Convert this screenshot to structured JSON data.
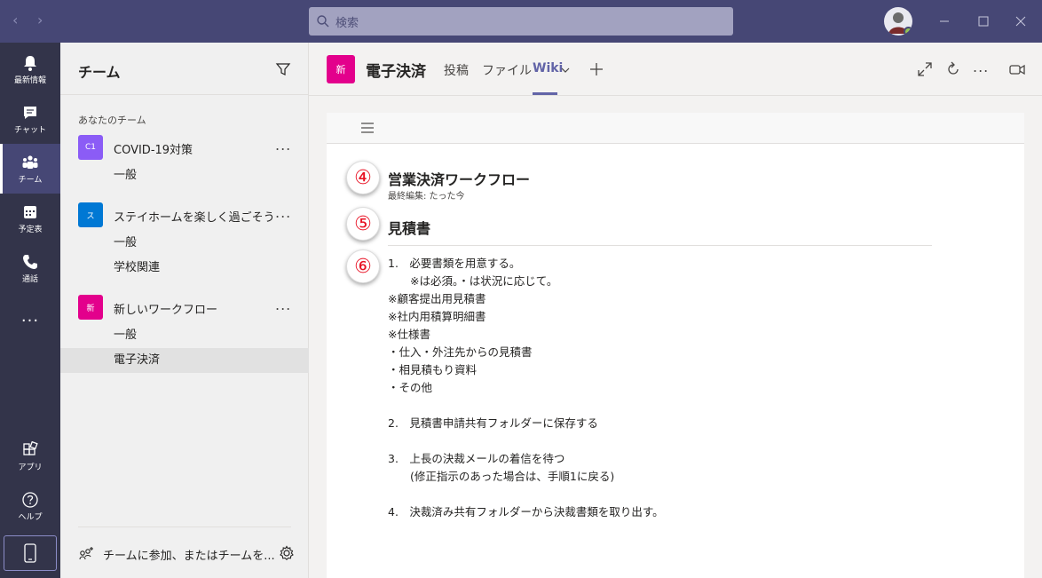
{
  "titlebar": {
    "search_placeholder": "検索"
  },
  "rail": {
    "items": [
      {
        "label": "最新情報",
        "icon": "bell-icon"
      },
      {
        "label": "チャット",
        "icon": "chat-icon"
      },
      {
        "label": "チーム",
        "icon": "teams-icon"
      },
      {
        "label": "予定表",
        "icon": "calendar-icon"
      },
      {
        "label": "通話",
        "icon": "phone-icon"
      }
    ],
    "more": "...",
    "apps_label": "アプリ",
    "help_label": "ヘルプ"
  },
  "teams_panel": {
    "title": "チーム",
    "section_label": "あなたのチーム",
    "teams": [
      {
        "avatar": "C1",
        "avatar_color": "#8b5cf6",
        "name": "COVID-19対策",
        "channels": [
          "一般"
        ]
      },
      {
        "avatar": "ス",
        "avatar_color": "#0078d4",
        "name": "ステイホームを楽しく過ごそう",
        "channels": [
          "一般",
          "学校関連"
        ]
      },
      {
        "avatar": "新",
        "avatar_color": "#e3008c",
        "name": "新しいワークフロー",
        "channels": [
          "一般",
          "電子決済"
        ]
      }
    ],
    "more": "...",
    "join_label": "チームに参加、またはチームを..."
  },
  "channel_header": {
    "avatar": "新",
    "title": "電子決済",
    "tabs": [
      "投稿",
      "ファイル",
      "Wiki"
    ],
    "active_tab": "Wiki",
    "more": "..."
  },
  "wiki": {
    "markers": [
      "④",
      "⑤",
      "⑥"
    ],
    "page_title": "営業決済ワークフロー",
    "last_edited": "最終編集: たった今",
    "section_title": "見積書",
    "lines": [
      "1.　必要書類を用意する。",
      "　　※は必須。・は状況に応じて。",
      "※顧客提出用見積書",
      "※社内用積算明細書",
      "※仕様書",
      "・仕入・外注先からの見積書",
      "・相見積もり資料",
      "・その他",
      "",
      "2.　見積書申請共有フォルダーに保存する",
      "",
      "3.　上長の決裁メールの着信を待つ",
      "　　(修正指示のあった場合は、手順1に戻る)",
      "",
      "4.　決裁済み共有フォルダーから決裁書類を取り出す。"
    ]
  }
}
